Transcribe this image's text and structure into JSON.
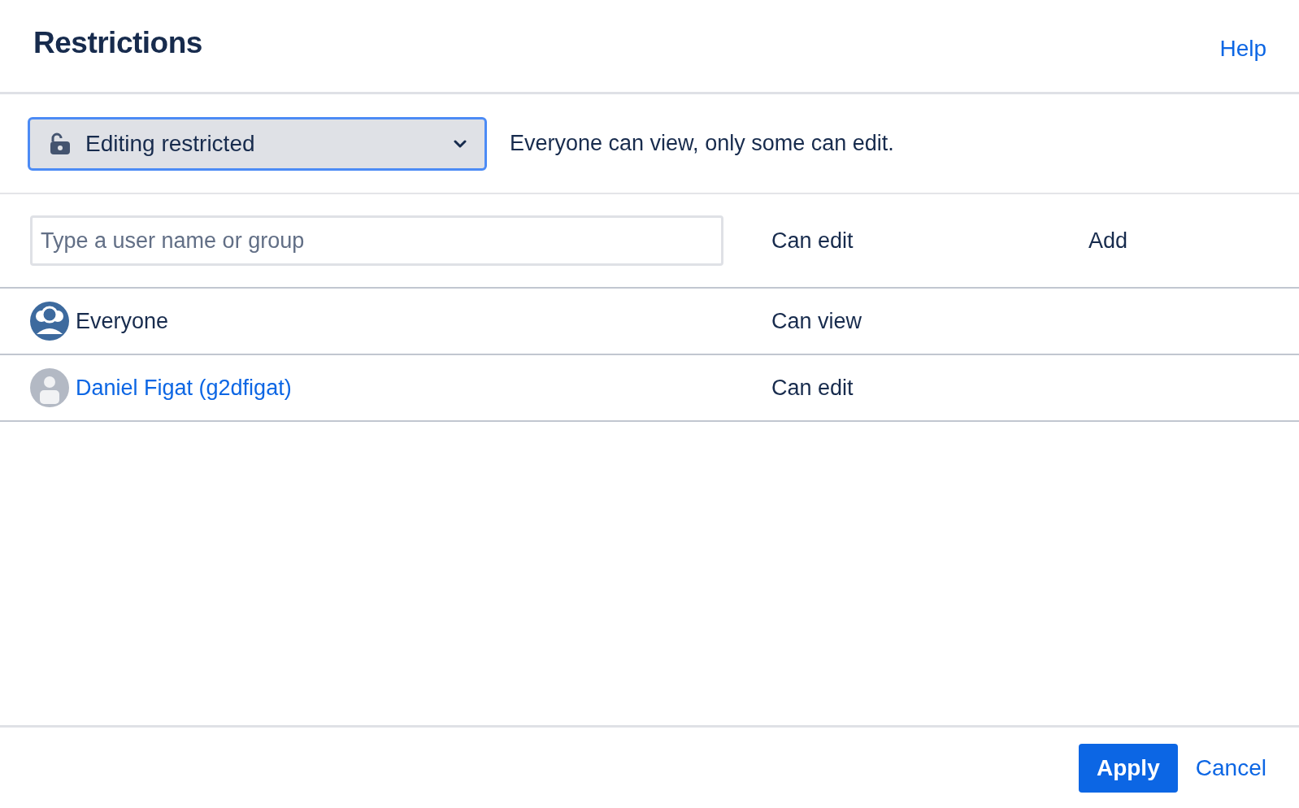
{
  "title": "Restrictions",
  "help_link": "Help",
  "restriction": {
    "selected_option": "Editing restricted",
    "description": "Everyone can view, only some can edit."
  },
  "add_row": {
    "placeholder": "Type a user name or group",
    "permission": "Can edit",
    "add_button": "Add"
  },
  "entries": [
    {
      "kind": "group",
      "name": "Everyone",
      "permission": "Can view"
    },
    {
      "kind": "user",
      "name": "Daniel Figat (g2dfigat)",
      "permission": "Can edit"
    }
  ],
  "buttons": {
    "apply": "Apply",
    "cancel": "Cancel"
  }
}
